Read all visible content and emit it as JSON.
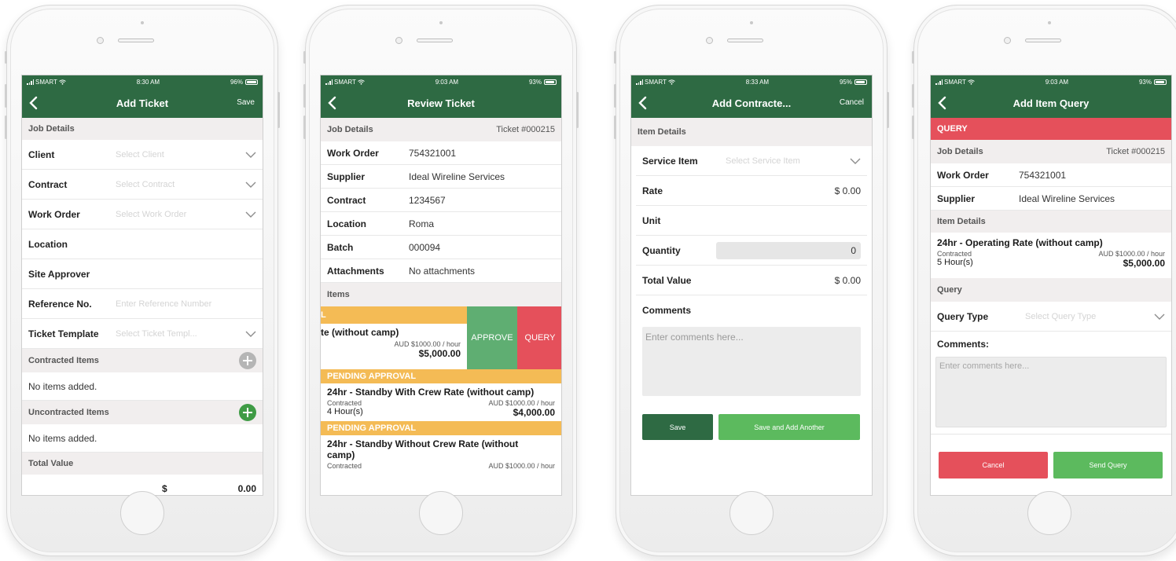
{
  "status": [
    {
      "carrier": "SMART",
      "time": "8:30 AM",
      "battery": "96%",
      "battery_level": 0.96
    },
    {
      "carrier": "SMART",
      "time": "9:03 AM",
      "battery": "93%",
      "battery_level": 0.93
    },
    {
      "carrier": "SMART",
      "time": "8:33 AM",
      "battery": "95%",
      "battery_level": 0.95
    },
    {
      "carrier": "SMART",
      "time": "9:03 AM",
      "battery": "93%",
      "battery_level": 0.93
    }
  ],
  "colors": {
    "header_green": "#2e6a43",
    "section_bg": "#f1eeee",
    "pending_orange": "#f4bb55",
    "approve_green": "#5fae72",
    "query_red": "#e5505b",
    "button_dark_green": "#2e6a43",
    "button_light_green": "#5cba5e",
    "add_grey": "#b5b5b5",
    "add_green": "#3f9b45"
  },
  "add_ticket": {
    "title": "Add Ticket",
    "action": "Save",
    "job_details": "Job Details",
    "fields": [
      {
        "label": "Client",
        "placeholder": "Select Client",
        "chevron": true
      },
      {
        "label": "Contract",
        "placeholder": "Select Contract",
        "chevron": true
      },
      {
        "label": "Work Order",
        "placeholder": "Select Work Order",
        "chevron": true
      },
      {
        "label": "Location",
        "placeholder": "",
        "chevron": false
      },
      {
        "label": "Site Approver",
        "placeholder": "",
        "chevron": false
      },
      {
        "label": "Reference No.",
        "placeholder": "Enter Reference Number",
        "chevron": false
      },
      {
        "label": "Ticket Template",
        "placeholder": "Select Ticket Templ...",
        "chevron": true
      }
    ],
    "contracted_items": "Contracted Items",
    "contracted_empty": "No items added.",
    "uncontracted_items": "Uncontracted Items",
    "uncontracted_empty": "No items added.",
    "total_value": "Total Value",
    "currency": "$",
    "total": "0.00"
  },
  "review_ticket": {
    "title": "Review Ticket",
    "job_details": "Job Details",
    "ticket_no": "Ticket #000215",
    "fields": [
      {
        "label": "Work Order",
        "value": "754321001"
      },
      {
        "label": "Supplier",
        "value": "Ideal Wireline Services"
      },
      {
        "label": "Contract",
        "value": "1234567"
      },
      {
        "label": "Location",
        "value": "Roma"
      },
      {
        "label": "Batch",
        "value": "000094"
      },
      {
        "label": "Attachments",
        "value": "No attachments"
      }
    ],
    "items_label": "Items",
    "swiped_item": {
      "status": "L",
      "title": "te (without camp)",
      "rate": "AUD $1000.00 / hour",
      "amount": "$5,000.00",
      "approve": "APPROVE",
      "query": "QUERY"
    },
    "items": [
      {
        "status": "PENDING APPROVAL",
        "title": "24hr - Standby With Crew Rate (without camp)",
        "type": "Contracted",
        "rate": "AUD $1000.00 / hour",
        "qty": "4  Hour(s)",
        "amount": "$4,000.00"
      },
      {
        "status": "PENDING APPROVAL",
        "title": "24hr - Standby Without Crew Rate (without camp)",
        "type": "Contracted",
        "rate": "AUD $1000.00 / hour",
        "qty": "",
        "amount": ""
      }
    ]
  },
  "add_contracted": {
    "title": "Add Contracte...",
    "action": "Cancel",
    "item_details": "Item Details",
    "service_item": {
      "label": "Service Item",
      "placeholder": "Select Service Item"
    },
    "rate": {
      "label": "Rate",
      "value": "$ 0.00"
    },
    "unit": {
      "label": "Unit",
      "value": ""
    },
    "quantity": {
      "label": "Quantity",
      "value": "0"
    },
    "total_value": {
      "label": "Total Value",
      "value": "$ 0.00"
    },
    "comments": {
      "label": "Comments",
      "placeholder": "Enter comments here..."
    },
    "save": "Save",
    "save_add": "Save and Add Another"
  },
  "add_item_query": {
    "title": "Add Item Query",
    "banner": "QUERY",
    "job_details": "Job Details",
    "ticket_no": "Ticket #000215",
    "fields": [
      {
        "label": "Work Order",
        "value": "754321001"
      },
      {
        "label": "Supplier",
        "value": "Ideal Wireline Services"
      }
    ],
    "item_details": "Item Details",
    "item": {
      "title": "24hr - Operating Rate (without camp)",
      "type": "Contracted",
      "rate": "AUD $1000.00 / hour",
      "qty": "5  Hour(s)",
      "amount": "$5,000.00"
    },
    "query_section": "Query",
    "query_type": {
      "label": "Query Type",
      "placeholder": "Select Query Type"
    },
    "comments": {
      "label": "Comments:",
      "placeholder": "Enter comments here..."
    },
    "cancel": "Cancel",
    "send": "Send Query"
  }
}
